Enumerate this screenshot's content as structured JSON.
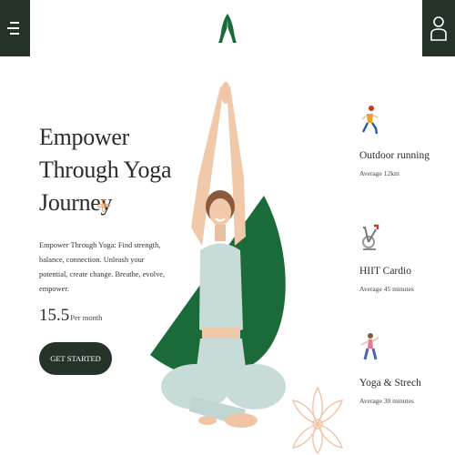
{
  "header": {
    "menu_icon": "menu-icon",
    "logo_icon": "praying-hands-logo-icon",
    "user_icon": "user-icon",
    "brand_color": "#1b6b3a",
    "dark_color": "#243228"
  },
  "hero": {
    "title_lines": [
      "Empower",
      "Through Yoga",
      "Journey"
    ],
    "title_icon": "flower-icon",
    "description": "Empower Through Yoga: Find strength, balance, connection. Unleash your potential, create change. Breathe, evolve, empower.",
    "price": "15.5",
    "price_suffix": "Per month",
    "cta_label": "GET STARTED",
    "image": "woman-yoga-pose-image",
    "decor_icon": "lotus-mandala-icon"
  },
  "features": [
    {
      "icon": "runner-icon",
      "title": "Outdoor running",
      "subtitle": "Average 12km"
    },
    {
      "icon": "exercise-bike-icon",
      "title": "HIIT Cardio",
      "subtitle": "Average 45 minutes"
    },
    {
      "icon": "yoga-pose-icon",
      "title": "Yoga & Strech",
      "subtitle": "Average 30 minutes"
    }
  ]
}
